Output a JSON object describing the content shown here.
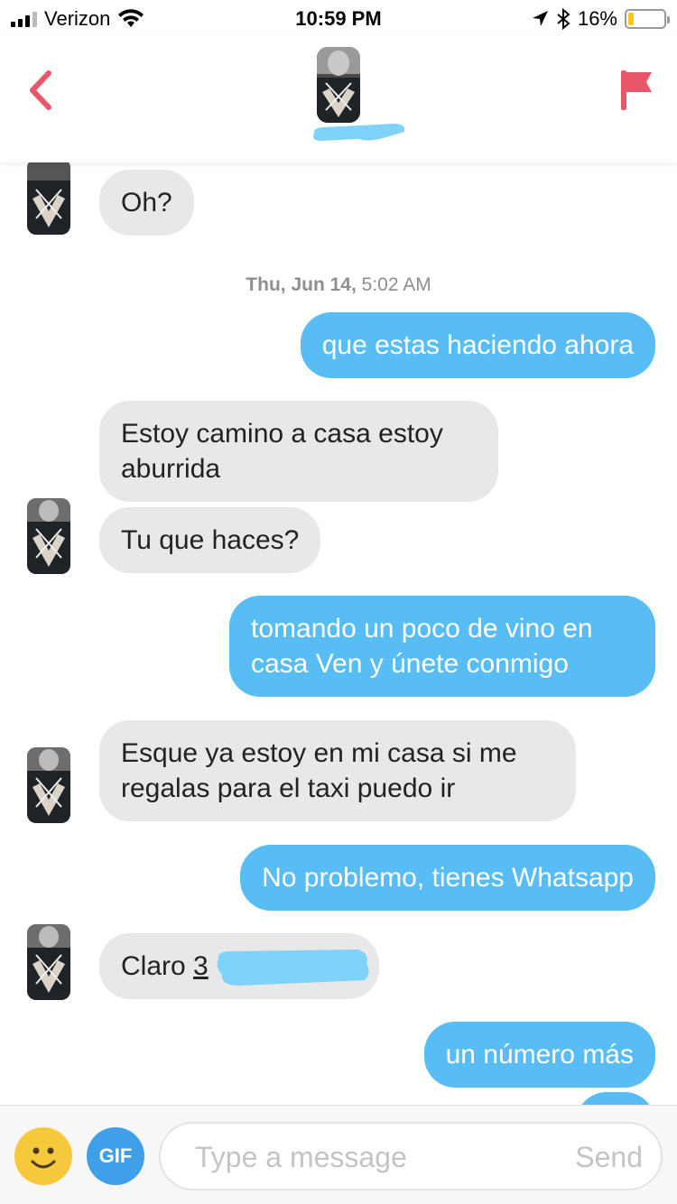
{
  "status_bar": {
    "carrier": "Verizon",
    "time": "10:59 PM",
    "battery": "16%",
    "battery_level": 0.16
  },
  "header": {
    "back_icon": "chevron-left-icon",
    "flag_icon": "flag-icon",
    "accent_color": "#e8566a"
  },
  "chat": {
    "timestamp_date": "Thu, Jun 14,",
    "timestamp_time": " 5:02 AM",
    "messages": [
      {
        "sender": "them",
        "text": "Oh?"
      },
      {
        "sender": "me",
        "text": "que estas haciendo ahora"
      },
      {
        "sender": "them",
        "text": "Estoy camino a casa estoy aburrida"
      },
      {
        "sender": "them",
        "text": "Tu que haces?"
      },
      {
        "sender": "me",
        "text": "tomando un poco de vino en casa Ven y únete conmigo"
      },
      {
        "sender": "them",
        "text": "Esque ya estoy en mi casa si me regalas para el taxi puedo ir"
      },
      {
        "sender": "me",
        "text": "No problemo, tienes Whatsapp"
      },
      {
        "sender": "them",
        "text_prefix": "Claro ",
        "text_link": "3"
      },
      {
        "sender": "me",
        "text": "un número más"
      }
    ]
  },
  "composer": {
    "emoji_icon": "smiley-icon",
    "gif_label": "GIF",
    "placeholder": "Type a message",
    "send_label": "Send"
  },
  "colors": {
    "outgoing_bubble": "#58bdf5",
    "incoming_bubble": "#e8e8e8",
    "redaction": "#7fd3fb"
  }
}
